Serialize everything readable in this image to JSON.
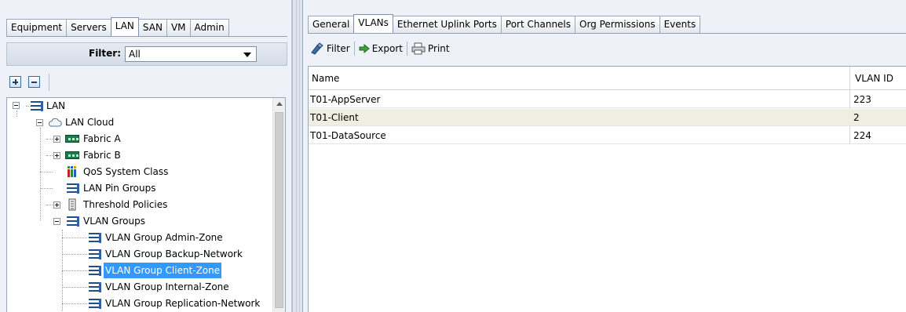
{
  "nav_tabs": [
    {
      "label": "Equipment"
    },
    {
      "label": "Servers"
    },
    {
      "label": "LAN",
      "active": true
    },
    {
      "label": "SAN"
    },
    {
      "label": "VM"
    },
    {
      "label": "Admin"
    }
  ],
  "filter": {
    "label": "Filter:",
    "value": "All"
  },
  "tree": {
    "root": "LAN",
    "cloud": "LAN Cloud",
    "fabric_a": "Fabric A",
    "fabric_b": "Fabric B",
    "qos": "QoS System Class",
    "pin_groups": "LAN Pin Groups",
    "threshold": "Threshold Policies",
    "vlan_groups": "VLAN Groups",
    "groups": [
      {
        "label": "VLAN Group Admin-Zone"
      },
      {
        "label": "VLAN Group Backup-Network"
      },
      {
        "label": "VLAN Group Client-Zone",
        "selected": true
      },
      {
        "label": "VLAN Group Internal-Zone"
      },
      {
        "label": "VLAN Group Replication-Network"
      }
    ]
  },
  "detail_tabs": [
    {
      "label": "General"
    },
    {
      "label": "VLANs",
      "active": true
    },
    {
      "label": "Ethernet Uplink Ports"
    },
    {
      "label": "Port Channels"
    },
    {
      "label": "Org Permissions"
    },
    {
      "label": "Events"
    }
  ],
  "toolbar": {
    "filter_label": "Filter",
    "export_label": "Export",
    "print_label": "Print"
  },
  "table": {
    "columns": [
      "Name",
      "VLAN ID"
    ],
    "rows": [
      {
        "name": "T01-AppServer",
        "vlan_id": "223"
      },
      {
        "name": "T01-Client",
        "vlan_id": "2",
        "selected": true
      },
      {
        "name": "T01-DataSource",
        "vlan_id": "224"
      }
    ]
  },
  "colors": {
    "pane_bg": "#eef2f8",
    "selection": "#3399ff",
    "row_highlight": "#efefe1",
    "tree_icon_blue": "#1f4f8a",
    "fabric_green": "#1c7a4f"
  }
}
